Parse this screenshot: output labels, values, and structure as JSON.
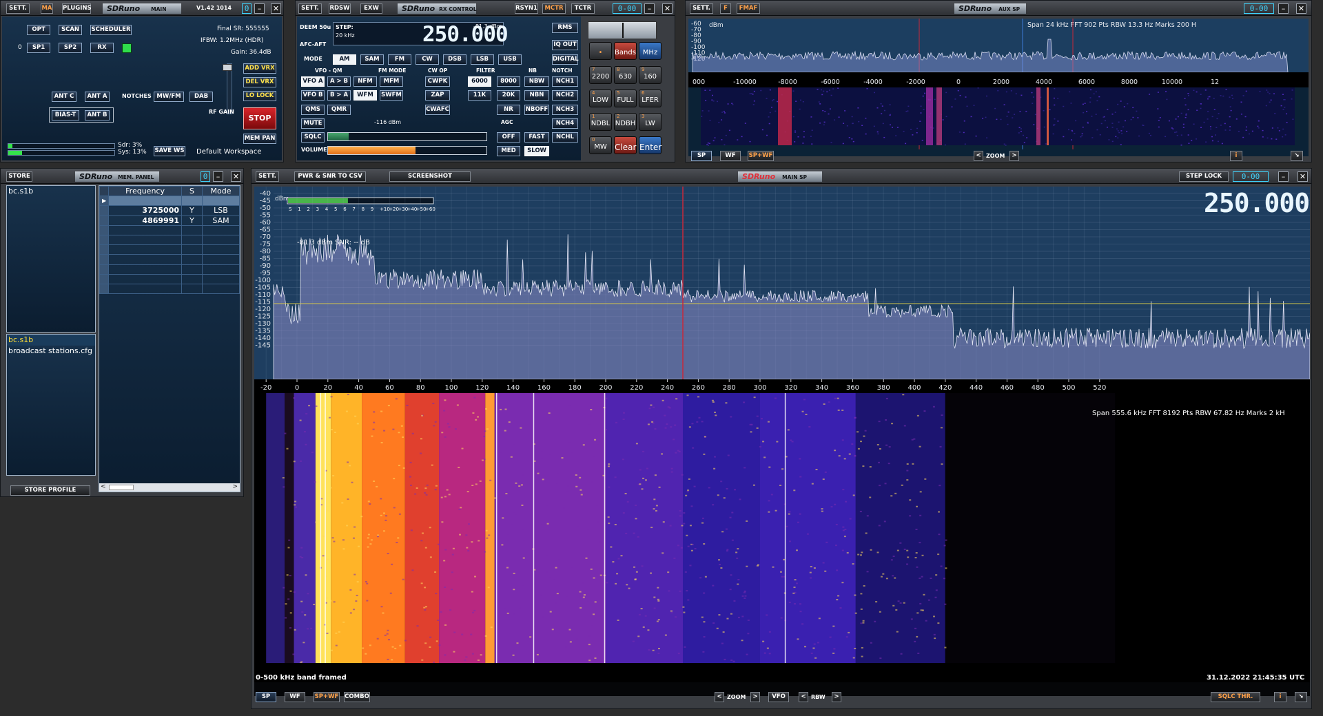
{
  "main": {
    "buttons": {
      "sett": "SETT.",
      "ma": "MA",
      "plugins": "PLUGINS",
      "opt": "OPT",
      "scan": "SCAN",
      "scheduler": "SCHEDULER",
      "sp1": "SP1",
      "sp2": "SP2",
      "rx": "RX",
      "add_vrx": "ADD VRX",
      "del_vrx": "DEL VRX",
      "lo_lock": "LO LOCK",
      "ant_c": "ANT C",
      "ant_a": "ANT A",
      "notches": "NOTCHES",
      "mwfm": "MW/FM",
      "dab": "DAB",
      "bias_t": "BIAS-T",
      "ant_b": "ANT B",
      "rf_gain": "RF GAIN",
      "stop": "STOP",
      "mem_pan": "MEM PAN",
      "save_ws": "SAVE WS"
    },
    "logo": "SDRuno",
    "logo_sub": "MAIN",
    "version": "V1.42 1014",
    "final_sr": "Final SR: 555555",
    "ifbw": "IFBW: 1.2MHz (HDR)",
    "gain": "Gain: 36.4dB",
    "rx_count": "0",
    "sdr": "Sdr: 3%",
    "sys": "Sys: 13%",
    "workspace": "Default Workspace",
    "indicator": "0"
  },
  "rx": {
    "title_buttons": {
      "sett": "SETT.",
      "rdsw": "RDSW",
      "exw": "EXW",
      "rsyn1": "RSYN1",
      "mctr": "MCTR",
      "tctr": "TCTR"
    },
    "logo": "SDRuno",
    "logo_sub": "RX CONTROL",
    "indicator": "0-00",
    "deem": "DEEM 50u",
    "step": "STEP:",
    "step_val": "20 kHz",
    "afc": "AFC-AFT",
    "level": "-81.3 dBm",
    "freq": "250.000",
    "squelch_level": "-116 dBm",
    "labels": {
      "mode": "MODE",
      "vfo_qm": "VFO - QM",
      "fm_mode": "FM MODE",
      "cw_op": "CW OP",
      "filter": "FILTER",
      "nb": "NB",
      "notch": "NOTCH",
      "mute": "MUTE",
      "sqlc": "SQLC",
      "agc": "AGC",
      "volume": "VOLUME"
    },
    "right_buttons": {
      "rms": "RMS",
      "iq_out": "IQ OUT",
      "digital": "DIGITAL"
    },
    "modes": [
      "AM",
      "SAM",
      "FM",
      "CW",
      "DSB",
      "LSB",
      "USB"
    ],
    "row1": [
      "VFO A",
      "A > B",
      "NFM",
      "MFM",
      "CWPK",
      "6000",
      "8000",
      "NBW",
      "NCH1"
    ],
    "row2": [
      "VFO B",
      "B > A",
      "WFM",
      "SWFM",
      "ZAP",
      "11K",
      "20K",
      "NBN",
      "NCH2"
    ],
    "row3": [
      "QMS",
      "QMR",
      "CWAFC",
      "NR",
      "NBOFF",
      "NCH3"
    ],
    "nch4": "NCH4",
    "nchl": "NCHL",
    "agc_btns": [
      "OFF",
      "FAST",
      "MED",
      "SLOW"
    ],
    "volume_pct": 0.55,
    "keypad": [
      {
        "n": "",
        "t": "•"
      },
      {
        "n": "",
        "t": "Bands"
      },
      {
        "n": "",
        "t": "MHz"
      },
      {
        "n": "7",
        "t": "2200"
      },
      {
        "n": "8",
        "t": "630"
      },
      {
        "n": "9",
        "t": "160"
      },
      {
        "n": "4",
        "t": "LOW"
      },
      {
        "n": "5",
        "t": "FULL"
      },
      {
        "n": "6",
        "t": "LFER"
      },
      {
        "n": "1",
        "t": "NDBL"
      },
      {
        "n": "2",
        "t": "NDBH"
      },
      {
        "n": "3",
        "t": "LW"
      },
      {
        "n": "0",
        "t": "MW"
      },
      {
        "n": "",
        "t": "Clear"
      },
      {
        "n": "",
        "t": "Enter"
      }
    ]
  },
  "aux": {
    "buttons": {
      "sett": "SETT.",
      "f": "F",
      "fmaf": "FMAF",
      "sp": "SP",
      "wf": "WF",
      "spwf": "SP+WF",
      "zoom": "ZOOM",
      "info": "i"
    },
    "logo": "SDRuno",
    "logo_sub": "AUX SP",
    "indicator": "0-00",
    "unit": "dBm",
    "db_ticks": [
      "-60",
      "-70",
      "-80",
      "-90",
      "-100",
      "-110",
      "-120"
    ],
    "info": "Span 24 kHz  FFT 902 Pts  RBW 13.3 Hz  Marks 200 H",
    "x_ticks": [
      "000",
      "-10000",
      "-8000",
      "-6000",
      "-4000",
      "-2000",
      "0",
      "2000",
      "4000",
      "6000",
      "8000",
      "10000",
      "12"
    ]
  },
  "mem": {
    "store": "STORE",
    "logo": "SDRuno",
    "logo_sub": "MEM. PANEL",
    "indicator": "0",
    "file1": "bc.s1b",
    "file2": "bc.s1b",
    "file3": "broadcast stations.cfg",
    "headers": [
      "Frequency",
      "S",
      "Mode"
    ],
    "rows": [
      [
        "",
        "",
        ""
      ],
      [
        "3725000",
        "Y",
        "LSB"
      ],
      [
        "4869991",
        "Y",
        "SAM"
      ],
      [
        "",
        "",
        ""
      ],
      [
        "",
        "",
        ""
      ],
      [
        "",
        "",
        ""
      ],
      [
        "",
        "",
        ""
      ],
      [
        "",
        "",
        ""
      ],
      [
        "",
        "",
        ""
      ],
      [
        "",
        "",
        ""
      ]
    ],
    "store_profile": "STORE PROFILE"
  },
  "mainsp": {
    "buttons": {
      "sett": "SETT.",
      "pwr": "PWR & SNR TO CSV",
      "screenshot": "SCREENSHOT",
      "step_lock": "STEP LOCK",
      "sp": "SP",
      "wf": "WF",
      "spwf": "SP+WF",
      "combo": "COMBO",
      "zoom": "ZOOM",
      "vfo": "VFO",
      "rbw": "RBW",
      "sqlc_thr": "SQLC THR.",
      "info": "i"
    },
    "logo": "SDRuno",
    "logo_sub": "MAIN SP",
    "indicator": "0-00",
    "freq": "250.000",
    "unit": "dBm",
    "db_ticks": [
      "-40",
      "-45",
      "-50",
      "-55",
      "-60",
      "-65",
      "-70",
      "-75",
      "-80",
      "-85",
      "-90",
      "-95",
      "-100",
      "-105",
      "-110",
      "-115",
      "-120",
      "-125",
      "-130",
      "-135",
      "-140",
      "-145"
    ],
    "smeter": [
      "S",
      "1",
      "2",
      "3",
      "4",
      "5",
      "6",
      "7",
      "8",
      "9",
      "+10",
      "+20",
      "+30",
      "+40",
      "+50",
      "+60"
    ],
    "smeter_fill": 0.41,
    "readout": "-81.3 dBm   SNR: -- dB",
    "info": "Span 555.6 kHz  FFT 8192 Pts  RBW 67.82 Hz  Marks 2 kH",
    "x_ticks": [
      "-20",
      "0",
      "20",
      "40",
      "60",
      "80",
      "100",
      "120",
      "140",
      "160",
      "180",
      "200",
      "220",
      "240",
      "260",
      "280",
      "300",
      "320",
      "340",
      "360",
      "380",
      "400",
      "420",
      "440",
      "460",
      "480",
      "500",
      "520"
    ],
    "caption": "0-500 kHz band framed",
    "timestamp": "31.12.2022 21:45:35 UTC"
  }
}
